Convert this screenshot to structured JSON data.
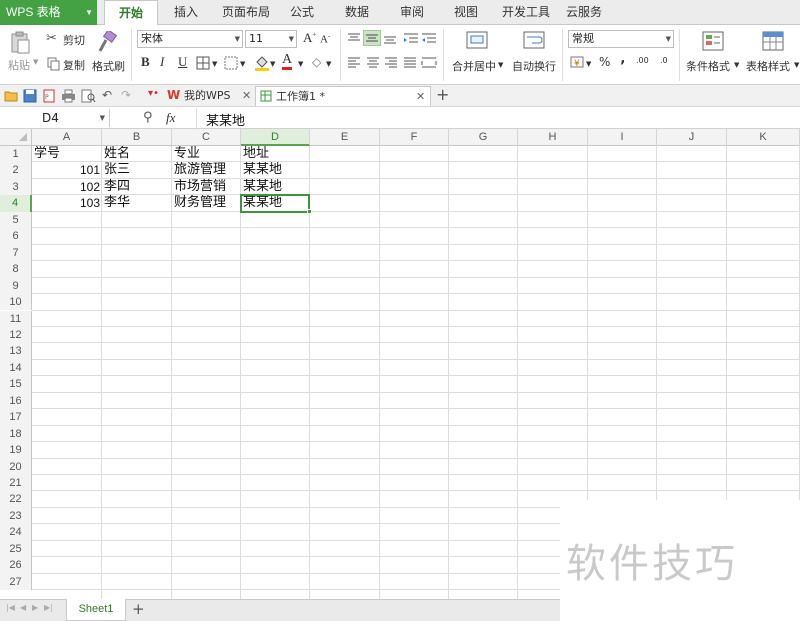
{
  "app": {
    "logo": "WPS 表格"
  },
  "menu": [
    "开始",
    "插入",
    "页面布局",
    "公式",
    "数据",
    "审阅",
    "视图",
    "开发工具",
    "云服务"
  ],
  "ribbon": {
    "paste": "粘贴",
    "cut": "剪切",
    "copy": "复制",
    "format_painter": "格式刷",
    "font_name": "宋体",
    "font_size": "11",
    "merge_center": "合并居中",
    "wrap_text": "自动换行",
    "number_format": "常规",
    "percent": "%",
    "comma": "‚",
    "cond_format": "条件格式",
    "table_style": "表格样式",
    "bold": "B",
    "italic": "I",
    "underline": "U",
    "font_color_letter": "A",
    "increase_decimal": ".00",
    "decrease_decimal": ".0"
  },
  "tabs": {
    "mywps": "我的WPS",
    "workbook": "工作簿1 *",
    "add": "+"
  },
  "formula_bar": {
    "cell_ref": "D4",
    "fx": "fx",
    "value": "某某地"
  },
  "columns": [
    "A",
    "B",
    "C",
    "D",
    "E",
    "F",
    "G",
    "H",
    "I",
    "J",
    "K"
  ],
  "rows": [
    "1",
    "2",
    "3",
    "4",
    "5",
    "6",
    "7",
    "8",
    "9",
    "10",
    "11",
    "12",
    "13",
    "14",
    "15",
    "16",
    "17",
    "18",
    "19",
    "20",
    "21",
    "22",
    "23",
    "24",
    "25",
    "26",
    "27"
  ],
  "cells": {
    "A1": "学号",
    "B1": "姓名",
    "C1": "专业",
    "D1": "地址",
    "A2": "101",
    "B2": "张三",
    "C2": "旅游管理",
    "D2": "某某地",
    "A3": "102",
    "B3": "李四",
    "C3": "市场营销",
    "D3": "某某地",
    "A4": "103",
    "B4": "李华",
    "C4": "财务管理",
    "D4": "某某地"
  },
  "selected": {
    "column": "D",
    "row": "4"
  },
  "sheet": {
    "name": "Sheet1",
    "add": "+"
  },
  "watermark": "软件技巧",
  "colors": {
    "brand": "#44a244",
    "selection": "#3f9340",
    "header_bg": "#f3f3f3"
  }
}
